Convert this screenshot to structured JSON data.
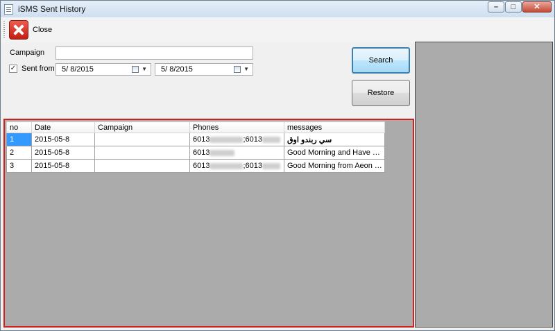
{
  "window": {
    "title": "iSMS Sent History",
    "buttons": {
      "minimize": "minimize-icon",
      "maximize": "maximize-icon",
      "close": "close-icon"
    }
  },
  "toolbar": {
    "close_label": "Close",
    "close_icon": "red-x-icon"
  },
  "filters": {
    "campaign_label": "Campaign",
    "campaign_value": "",
    "sent_from_label": "Sent from",
    "sent_from_checked": true,
    "date_from": "5/ 8/2015",
    "date_to": "5/ 8/2015"
  },
  "actions": {
    "search_label": "Search",
    "restore_label": "Restore"
  },
  "table": {
    "columns": [
      "no",
      "Date",
      "Campaign",
      "Phones",
      "messages"
    ],
    "rows": [
      {
        "no": "1",
        "date": "2015-05-8",
        "campaign": "",
        "phones_a": "6013",
        "phones_b": ";6013",
        "message": "سي ربندو اوق"
      },
      {
        "no": "2",
        "date": "2015-05-8",
        "campaign": "",
        "phones_a": "6013",
        "phones_b": "",
        "message": "Good Morning and Have a Ni..."
      },
      {
        "no": "3",
        "date": "2015-05-8",
        "campaign": "",
        "phones_a": "6013",
        "phones_b": ";6013",
        "message": "Good Morning from Aeon Tebr..."
      }
    ]
  },
  "colors": {
    "selection": "#3399ff",
    "highlight_border": "#d41f1f",
    "empty_area": "#ababab"
  }
}
